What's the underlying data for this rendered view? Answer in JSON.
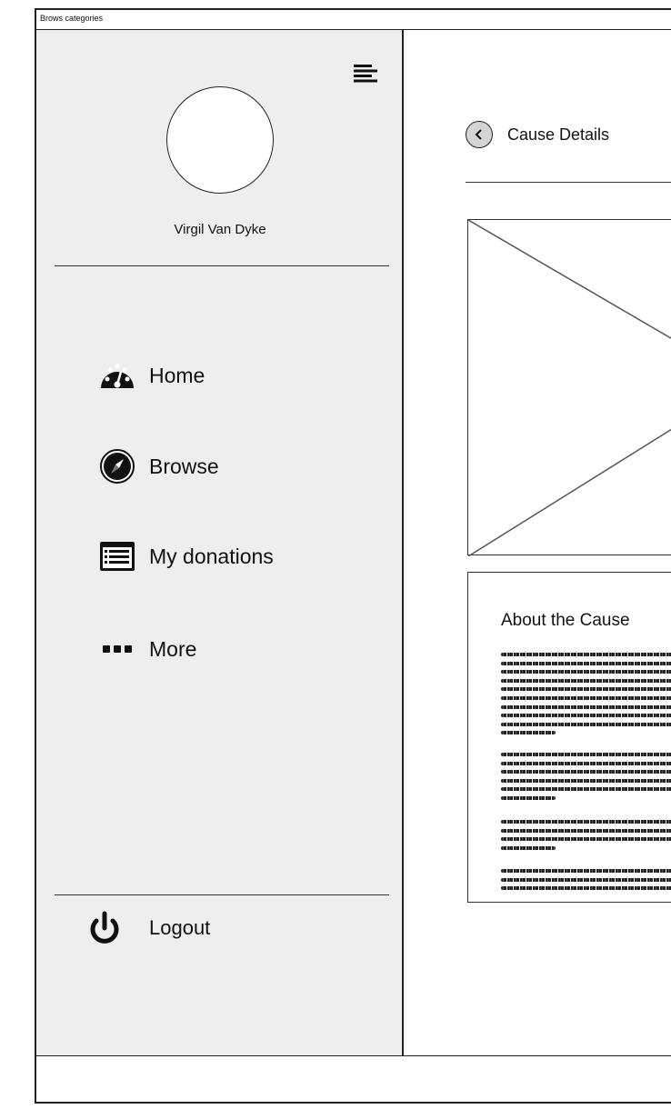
{
  "window": {
    "title": "Brows categories"
  },
  "sidebar": {
    "user_name": "Virgil Van Dyke",
    "menu_icon": "hamburger-icon",
    "items": [
      {
        "label": "Home",
        "icon": "dashboard-gauge-icon"
      },
      {
        "label": "Browse",
        "icon": "compass-icon"
      },
      {
        "label": "My donations",
        "icon": "list-icon"
      },
      {
        "label": "More",
        "icon": "more-dots-icon"
      }
    ],
    "logout_label": "Logout",
    "logout_icon": "power-icon"
  },
  "main": {
    "back_icon": "chevron-left-icon",
    "page_title": "Cause Details",
    "image_placeholder": "image-placeholder",
    "about_title": "About the Cause",
    "paragraph_line_counts": [
      10,
      6,
      4,
      3
    ]
  }
}
